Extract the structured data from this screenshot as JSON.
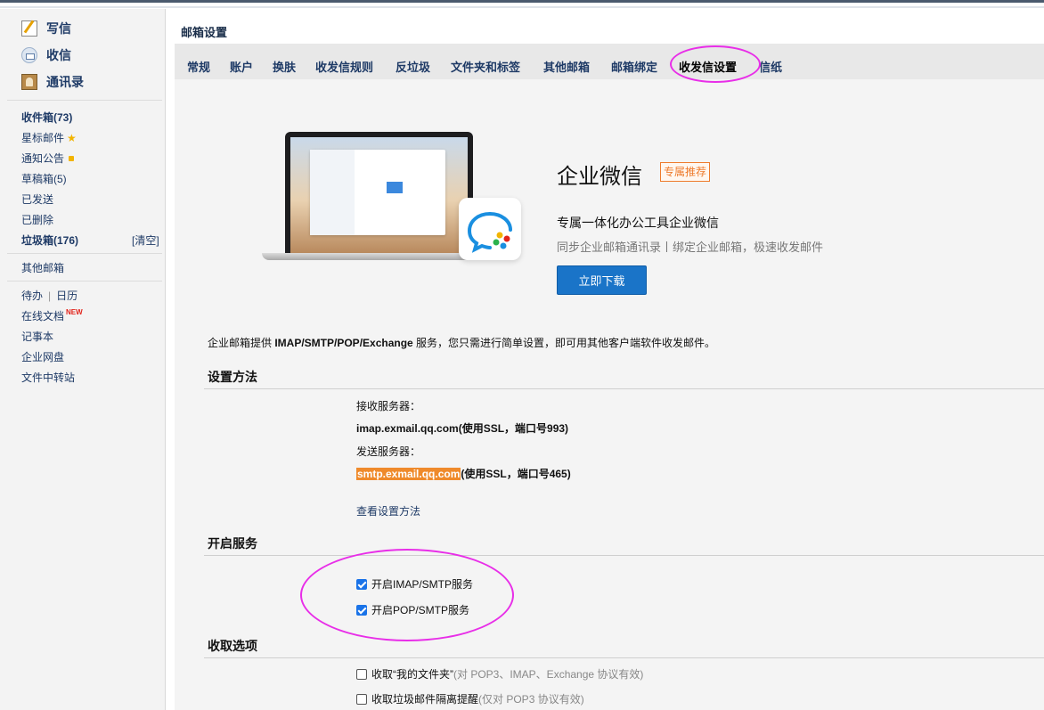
{
  "sidebar": {
    "actions": [
      {
        "label": "写信",
        "icon": "compose-icon"
      },
      {
        "label": "收信",
        "icon": "inbox-icon"
      },
      {
        "label": "通讯录",
        "icon": "contacts-icon"
      }
    ],
    "folders": {
      "inbox": "收件箱(73)",
      "starred": "星标邮件",
      "notices": "通知公告",
      "drafts": "草稿箱(5)",
      "sent": "已发送",
      "deleted": "已删除",
      "spam": "垃圾箱(176)",
      "spam_clear": "[清空]"
    },
    "other_mailbox": "其他邮箱",
    "tools": {
      "todo": "待办",
      "calendar": "日历",
      "online_docs": "在线文档",
      "new_tag": "NEW",
      "notes": "记事本",
      "netdisk": "企业网盘",
      "transfer": "文件中转站"
    }
  },
  "main": {
    "title": "邮箱设置",
    "tabs": [
      "常规",
      "账户",
      "换肤",
      "收发信规则",
      "反垃圾",
      "文件夹和标签",
      "其他邮箱",
      "邮箱绑定",
      "收发信设置",
      "信纸"
    ],
    "active_tab": "收发信设置"
  },
  "promo": {
    "title": "企业微信",
    "badge": "专属推荐",
    "subtitle": "专属一体化办公工具企业微信",
    "desc": "同步企业邮箱通讯录丨绑定企业邮箱，极速收发邮件",
    "button": "立即下载"
  },
  "intro": {
    "before": "企业邮箱提供 ",
    "strong": "IMAP/SMTP/POP/Exchange",
    "after": " 服务，您只需进行简单设置，即可用其他客户端软件收发邮件。"
  },
  "setup": {
    "title": "设置方法",
    "incoming_label": "接收服务器：",
    "incoming_value": "imap.exmail.qq.com(使用SSL，端口号993)",
    "outgoing_label": "发送服务器：",
    "outgoing_host": "smtp.exmail.qq.com",
    "outgoing_rest": "(使用SSL，端口号465)",
    "link": "查看设置方法"
  },
  "services": {
    "title": "开启服务",
    "imap_label": "开启IMAP/SMTP服务",
    "imap_checked": true,
    "pop_label": "开启POP/SMTP服务",
    "pop_checked": true
  },
  "receive": {
    "title": "收取选项",
    "opt1_label": "收取“我的文件夹”",
    "opt1_hint": " (对 POP3、IMAP、Exchange 协议有效)",
    "opt2_label": "收取垃圾邮件隔离提醒",
    "opt2_hint": " (仅对 POP3 协议有效)"
  },
  "colors": {
    "accent_blue": "#1a74c8",
    "highlight_orange": "#ef8a2b",
    "annotation_magenta": "#e82ee8"
  }
}
